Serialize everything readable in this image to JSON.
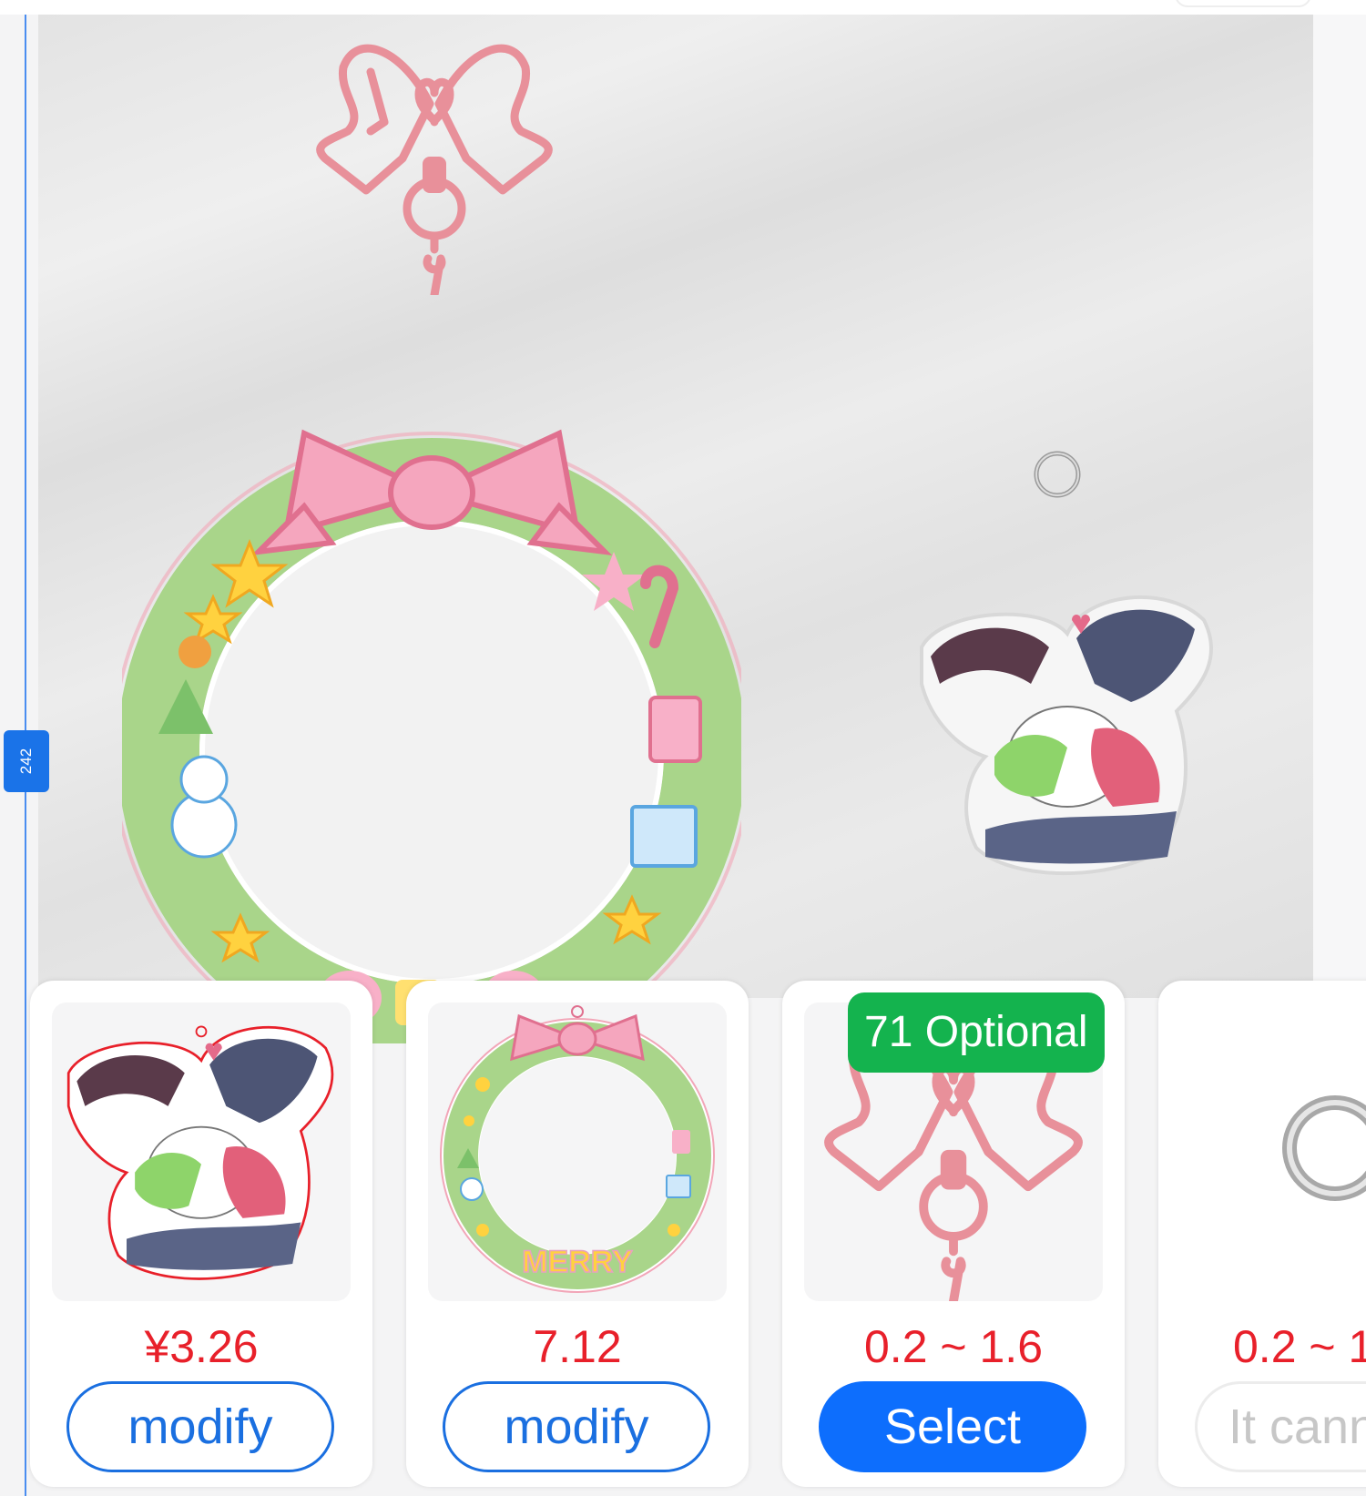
{
  "ruler": {
    "value": "242"
  },
  "canvas": {
    "items": [
      {
        "icon": "bow-clasp-icon"
      },
      {
        "icon": "wreath-acrylic-icon"
      },
      {
        "icon": "jump-ring-icon"
      },
      {
        "icon": "character-acrylic-icon"
      }
    ]
  },
  "cards": [
    {
      "icon": "character-acrylic-icon",
      "price": "¥3.26",
      "button_label": "modify",
      "button_style": "outline"
    },
    {
      "icon": "wreath-acrylic-icon",
      "price": "7.12",
      "button_label": "modify",
      "button_style": "outline",
      "thumb_text": "MERRY"
    },
    {
      "icon": "bow-clasp-icon",
      "tag": "71 Optional",
      "price": "0.2 ~ 1.6",
      "button_label": "Select",
      "button_style": "solid"
    },
    {
      "icon": "jump-ring-icon",
      "price": "0.2 ~ 1",
      "button_label": "It cann",
      "button_style": "disabled"
    }
  ],
  "colors": {
    "price_red": "#e8202a",
    "primary_blue": "#0d6efd",
    "tag_green": "#14b34e",
    "pink": "#e8909a",
    "wreath_green": "#a9d58a"
  }
}
